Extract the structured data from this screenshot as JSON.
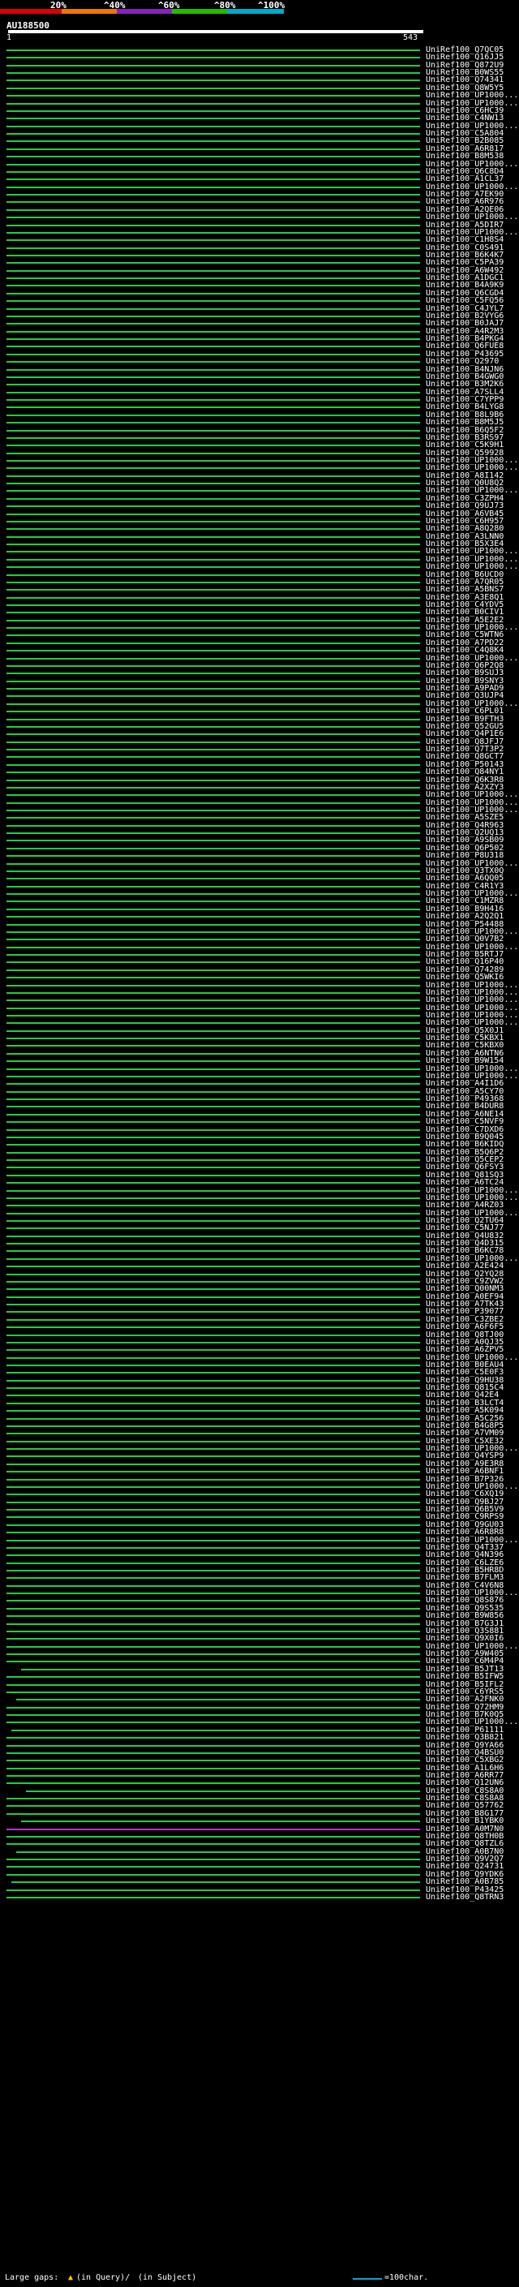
{
  "legend": {
    "pcts": [
      "20%",
      "^40%",
      "^60%",
      "^80%",
      "^100%"
    ],
    "colors": [
      "#dd0000",
      "#ee7700",
      "#8822bb",
      "#22bb00",
      "#00aacc"
    ]
  },
  "query": {
    "name": "AU188500",
    "start": "1",
    "end": "543"
  },
  "hits": [
    "UniRef100_Q7QC05",
    "UniRef100_Q16JJ5",
    "UniRef100_Q872U9",
    "UniRef100_B0WS55",
    "UniRef100_Q74341",
    "UniRef100_Q8W5Y5",
    "UniRef100_UP1000...",
    "UniRef100_UP1000...",
    "UniRef100_C6HC39",
    "UniRef100_C4NW13",
    "UniRef100_UP1000...",
    "UniRef100_C5A804",
    "UniRef100_B2B085",
    "UniRef100_A6R817",
    "UniRef100_B8M538",
    "UniRef100_UP1000...",
    "UniRef100_Q6C8D4",
    "UniRef100_A1CL37",
    "UniRef100_UP1000...",
    "UniRef100_A7EK90",
    "UniRef100_A6R976",
    "UniRef100_A2QE06",
    "UniRef100_UP1000...",
    "UniRef100_A5DIR7",
    "UniRef100_UP1000...",
    "UniRef100_C1H8S4",
    "UniRef100_C0S491",
    "UniRef100_B6K4K7",
    "UniRef100_C5PA39",
    "UniRef100_A6W492",
    "UniRef100_A1DGC1",
    "UniRef100_B4A9K9",
    "UniRef100_Q6CGD4",
    "UniRef100_C5FQ56",
    "UniRef100_C4JYL7",
    "UniRef100_B2VYG6",
    "UniRef100_B0JAJ7",
    "UniRef100_A4R2M3",
    "UniRef100_B4PKG4",
    "UniRef100_Q6FUE8",
    "UniRef100_P43695",
    "UniRef100_Q2970",
    "UniRef100_B4NJN6",
    "UniRef100_B4GWG0",
    "UniRef100_B3M2K6",
    "UniRef100_A7SLL4",
    "UniRef100_C7YPP9",
    "UniRef100_B4LYG8",
    "UniRef100_B8L9B6",
    "UniRef100_B8M5J5",
    "UniRef100_B6Q5F2",
    "UniRef100_B3RS97",
    "UniRef100_C5K9H1",
    "UniRef100_Q59928",
    "UniRef100_UP1000...",
    "UniRef100_UP1000...",
    "UniRef100_A8I142",
    "UniRef100_Q0U8Q2",
    "UniRef100_UP1000...",
    "UniRef100_C3ZPH4",
    "UniRef100_Q9UJ73",
    "UniRef100_A6VB45",
    "UniRef100_C6H957",
    "UniRef100_A8Q280",
    "UniRef100_A3LNN0",
    "UniRef100_B5X3E4",
    "UniRef100_UP1000...",
    "UniRef100_UP1000...",
    "UniRef100_UP1000...",
    "UniRef100_B6UCD0",
    "UniRef100_A7QR05",
    "UniRef100_A5BNS7",
    "UniRef100_A3E8Q1",
    "UniRef100_C4YDV5",
    "UniRef100_B0CIV1",
    "UniRef100_A5E2E2",
    "UniRef100_UP1000...",
    "UniRef100_C5WTN6",
    "UniRef100_A7PD22",
    "UniRef100_C4Q8K4",
    "UniRef100_UP1000...",
    "UniRef100_Q6P2Q8",
    "UniRef100_B9SUJ3",
    "UniRef100_B9SNY3",
    "UniRef100_A9PAD9",
    "UniRef100_Q3UJP4",
    "UniRef100_UP1000...",
    "UniRef100_C6PL01",
    "UniRef100_B9FTH3",
    "UniRef100_Q52GU5",
    "UniRef100_Q4P1E6",
    "UniRef100_Q8JFJ7",
    "UniRef100_Q7T3P2",
    "UniRef100_Q8GCT7",
    "UniRef100_P50143",
    "UniRef100_Q84NY1",
    "UniRef100_Q6K3R8",
    "UniRef100_A2XZY3",
    "UniRef100_UP1000...",
    "UniRef100_UP1000...",
    "UniRef100_UP1000...",
    "UniRef100_A5SZE5",
    "UniRef100_Q4R963",
    "UniRef100_Q2UQ13",
    "UniRef100_A9SB09",
    "UniRef100_Q6P502",
    "UniRef100_P8U318",
    "UniRef100_UP1000...",
    "UniRef100_Q3TX0Q",
    "UniRef100_A6QQ05",
    "UniRef100_C4R1Y3",
    "UniRef100_UP1000...",
    "UniRef100_C1MZR8",
    "UniRef100_B9H416",
    "UniRef100_A2Q2Q1",
    "UniRef100_P54488",
    "UniRef100_UP1000...",
    "UniRef100_Q0V7B2",
    "UniRef100_UP1000...",
    "UniRef100_B5RTJ7",
    "UniRef100_Q16P40",
    "UniRef100_Q74289",
    "UniRef100_Q5WKI6",
    "UniRef100_UP1000...",
    "UniRef100_UP1000...",
    "UniRef100_UP1000...",
    "UniRef100_UP1000...",
    "UniRef100_UP1000...",
    "UniRef100_UP1000...",
    "UniRef100_Q5X0J1",
    "UniRef100_C5KBX1",
    "UniRef100_C5KBX0",
    "UniRef100_A6NTN6",
    "UniRef100_B9W154",
    "UniRef100_UP1000...",
    "UniRef100_UP1000...",
    "UniRef100_A4I1D6",
    "UniRef100_A5CY70",
    "UniRef100_P49368",
    "UniRef100_B4DUR8",
    "UniRef100_A6NE14",
    "UniRef100_C5NVF9",
    "UniRef100_C7DXD6",
    "UniRef100_B9Q045",
    "UniRef100_B6KIDQ",
    "UniRef100_B5Q6P2",
    "UniRef100_Q5CEP2",
    "UniRef100_Q6FSY3",
    "UniRef100_Q81SQ3",
    "UniRef100_A6TC24",
    "UniRef100_UP1000...",
    "UniRef100_UP1000...",
    "UniRef100_A4RZ03",
    "UniRef100_UP1000...",
    "UniRef100_Q2TU64",
    "UniRef100_C5NJ77",
    "UniRef100_Q4U832",
    "UniRef100_Q4D315",
    "UniRef100_B6KC78",
    "UniRef100_UP1000...",
    "UniRef100_A2E424",
    "UniRef100_Q2YQ28",
    "UniRef100_C9ZVW2",
    "UniRef100_Q00NM3",
    "UniRef100_A0EF94",
    "UniRef100_A7TK43",
    "UniRef100_P39077",
    "UniRef100_C3ZBE2",
    "UniRef100_A6F6F5",
    "UniRef100_Q8TJ00",
    "UniRef100_A0QJ35",
    "UniRef100_A6ZPV5",
    "UniRef100_UP1000...",
    "UniRef100_B0EAU4",
    "UniRef100_C5E0F3",
    "UniRef100_Q9HU38",
    "UniRef100_Q815C4",
    "UniRef100_Q42E4",
    "UniRef100_B3LCT4",
    "UniRef100_A5K094",
    "UniRef100_A5C256",
    "UniRef100_B4G8P5",
    "UniRef100_A7VM09",
    "UniRef100_C5XE32",
    "UniRef100_UP1000...",
    "UniRef100_Q4YSP9",
    "UniRef100_A9E3R8",
    "UniRef100_A6BNF1",
    "UniRef100_B7P326",
    "UniRef100_UP1000...",
    "UniRef100_C6XQ19",
    "UniRef100_Q9BJ27",
    "UniRef100_Q6B5V9",
    "UniRef100_C9RPS9",
    "UniRef100_Q9GU03",
    "UniRef100_A6R8R8",
    "UniRef100_UP1000...",
    "UniRef100_Q4T337",
    "UniRef100_Q4N396",
    "UniRef100_C6LZE6",
    "UniRef100_B5HR8D",
    "UniRef100_B7FLM3",
    "UniRef100_C4V6N8",
    "UniRef100_UP1000...",
    "UniRef100_Q8S876",
    "UniRef100_Q9S535",
    "UniRef100_B9W856",
    "UniRef100_B7G3J1",
    "UniRef100_Q3S881",
    "UniRef100_Q9X0I6",
    "UniRef100_UP1000...",
    "UniRef100_A9W405",
    "UniRef100_C6M4P4",
    "UniRef100_B5JT13",
    "UniRef100_B5IFW5",
    "UniRef100_B5IFL2",
    "UniRef100_C6YRS5",
    "UniRef100_A2FNK0",
    "UniRef100_Q72HM9",
    "UniRef100_B7K0Q5",
    "UniRef100_UP1000...",
    "UniRef100_P61111",
    "UniRef100_Q3B821",
    "UniRef100_Q9YA66",
    "UniRef100_Q4BSU0",
    "UniRef100_C5XBG2",
    "UniRef100_A1L6H6",
    "UniRef100_A6RR77",
    "UniRef100_Q12UN6",
    "UniRef100_C8S8A0",
    "UniRef100_C8S8A8",
    "UniRef100_Q57762",
    "UniRef100_B8G177",
    "UniRef100_B1YBK0",
    "UniRef100_A0M7N0",
    "UniRef100_Q8TH0B",
    "UniRef100_Q8TZL6",
    "UniRef100_A0B7N0",
    "UniRef100_Q9V2Q7",
    "UniRef100_Q24731",
    "UniRef100_Q9YDK6",
    "UniRef100_A0B785",
    "UniRef100_P43425",
    "UniRef100_Q8TRN3"
  ],
  "footer": {
    "large_gaps": "Large gaps: ",
    "in_query": "(in Query)/",
    "in_subject": "(in Subject)",
    "scale": "=100char."
  }
}
